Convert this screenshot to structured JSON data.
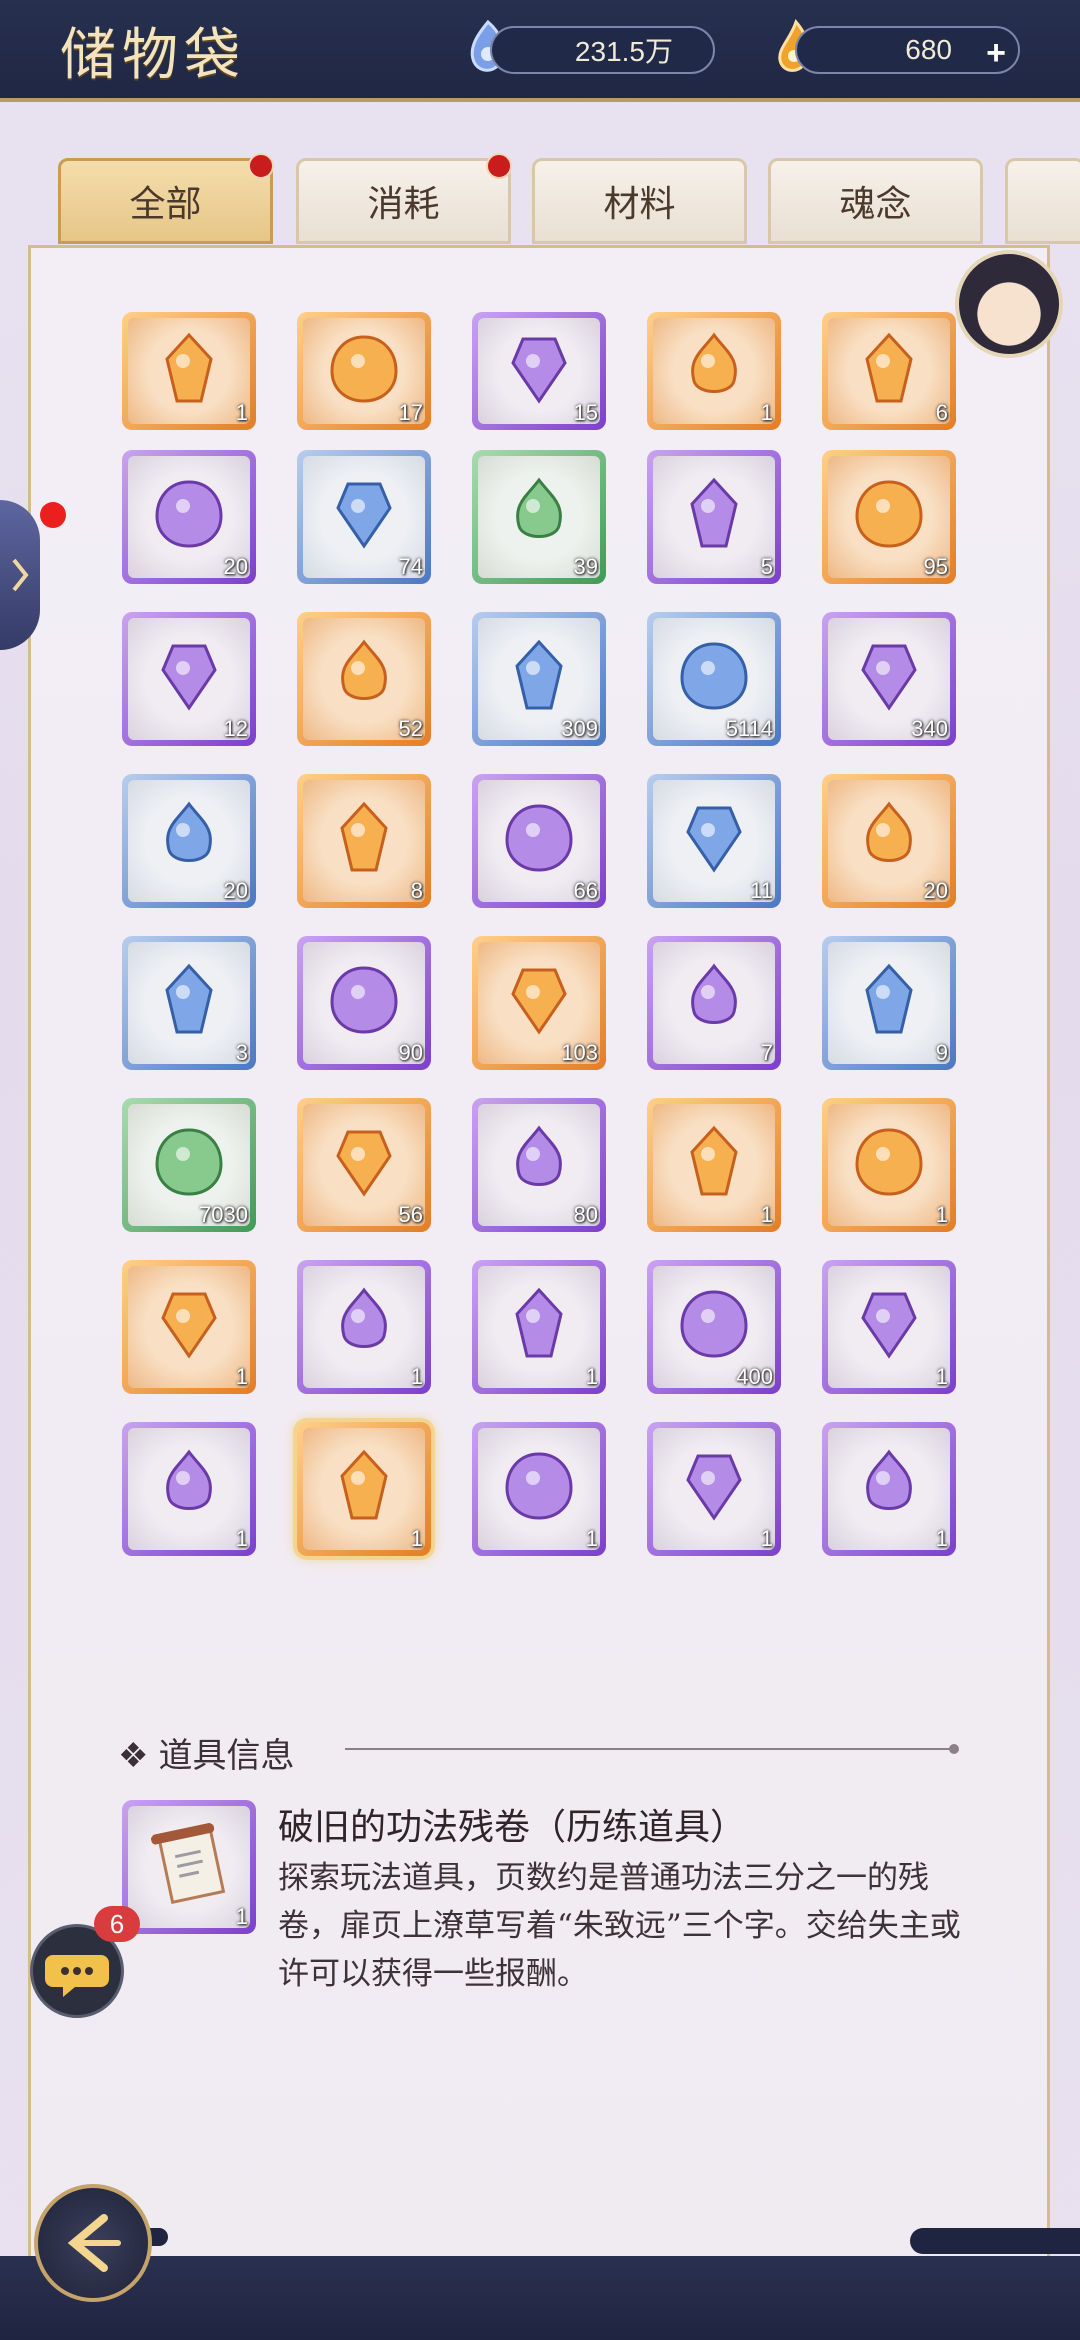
{
  "header": {
    "title": "储物袋",
    "currency_spirit": "231.5万",
    "currency_gold": "680"
  },
  "tabs": [
    {
      "label": "全部",
      "active": true,
      "badge": true
    },
    {
      "label": "消耗",
      "active": false,
      "badge": true
    },
    {
      "label": "材料",
      "active": false,
      "badge": false
    },
    {
      "label": "魂念",
      "active": false,
      "badge": false
    }
  ],
  "inventory": [
    {
      "count": "1",
      "quality": "orange",
      "icon": "flower-treasure-icon"
    },
    {
      "count": "17",
      "quality": "orange",
      "icon": "golden-flame-icon"
    },
    {
      "count": "15",
      "quality": "purple",
      "icon": "purple-flame-icon"
    },
    {
      "count": "1",
      "quality": "orange",
      "icon": "red-chest-icon"
    },
    {
      "count": "6",
      "quality": "orange",
      "icon": "wooden-instrument-icon"
    },
    {
      "count": "20",
      "quality": "purple",
      "icon": "potion-bottle-icon"
    },
    {
      "count": "74",
      "quality": "blue",
      "icon": "potion-bottle-icon"
    },
    {
      "count": "39",
      "quality": "green",
      "icon": "potion-bottle-icon"
    },
    {
      "count": "5",
      "quality": "purple",
      "icon": "gourd-icon"
    },
    {
      "count": "95",
      "quality": "orange",
      "icon": "flower-token-icon"
    },
    {
      "count": "12",
      "quality": "purple",
      "icon": "gem-on-stand-icon"
    },
    {
      "count": "52",
      "quality": "orange",
      "icon": "fox-figurine-icon"
    },
    {
      "count": "309",
      "quality": "blue",
      "icon": "spirit-orb-icon"
    },
    {
      "count": "5114",
      "quality": "blue",
      "icon": "jade-talisman-icon"
    },
    {
      "count": "340",
      "quality": "purple",
      "icon": "rune-crystal-icon"
    },
    {
      "count": "20",
      "quality": "blue",
      "icon": "ice-crystal-icon"
    },
    {
      "count": "8",
      "quality": "orange",
      "icon": "amber-pouch-icon"
    },
    {
      "count": "66",
      "quality": "purple",
      "icon": "amethyst-icon"
    },
    {
      "count": "11",
      "quality": "blue",
      "icon": "frost-egg-icon"
    },
    {
      "count": "20",
      "quality": "orange",
      "icon": "sun-moon-orb-icon"
    },
    {
      "count": "3",
      "quality": "blue",
      "icon": "amber-crystal-icon"
    },
    {
      "count": "90",
      "quality": "purple",
      "icon": "spirit-grass-icon"
    },
    {
      "count": "103",
      "quality": "orange",
      "icon": "violet-herb-icon"
    },
    {
      "count": "7",
      "quality": "purple",
      "icon": "berry-sprig-icon"
    },
    {
      "count": "9",
      "quality": "blue",
      "icon": "red-blossom-icon"
    },
    {
      "count": "7030",
      "quality": "green",
      "icon": "coral-icon"
    },
    {
      "count": "56",
      "quality": "orange",
      "icon": "gold-crystal-icon"
    },
    {
      "count": "80",
      "quality": "purple",
      "icon": "purple-crystal-icon"
    },
    {
      "count": "1",
      "quality": "orange",
      "icon": "ice-shards-icon"
    },
    {
      "count": "1",
      "quality": "orange",
      "icon": "paper-talisman-icon"
    },
    {
      "count": "1",
      "quality": "orange",
      "icon": "crest-plate-icon"
    },
    {
      "count": "1",
      "quality": "purple",
      "icon": "paper-talisman-icon"
    },
    {
      "count": "1",
      "quality": "purple",
      "icon": "sealed-scroll-icon"
    },
    {
      "count": "400",
      "quality": "purple",
      "icon": "green-pod-icon"
    },
    {
      "count": "1",
      "quality": "purple",
      "icon": "divine-seal-icon"
    },
    {
      "count": "1",
      "quality": "purple",
      "icon": "old-scroll-icon"
    },
    {
      "count": "1",
      "quality": "orange",
      "icon": "old-scroll-icon",
      "selected": true
    },
    {
      "count": "1",
      "quality": "purple",
      "icon": "dark-orb-icon"
    },
    {
      "count": "1",
      "quality": "purple",
      "icon": "flame-pearl-icon"
    },
    {
      "count": "1",
      "quality": "purple",
      "icon": "red-flame-pearl-icon"
    }
  ],
  "detail": {
    "section_title": "道具信息",
    "item_count": "1",
    "item_name": "破旧的功法残卷（历练道具）",
    "item_description": "探索玩法道具，页数约是普通功法三分之一的残卷，扉页上潦草写着“朱致远”三个字。交给失主或许可以获得一些报酬。"
  },
  "chat": {
    "unread": "6"
  },
  "colors": {
    "purple": "#7b3fcc",
    "orange": "#e47d23",
    "blue": "#4b77c4",
    "green": "#3f9b55",
    "header_bg": "#27304f",
    "gold_text": "#f4e4bd"
  }
}
